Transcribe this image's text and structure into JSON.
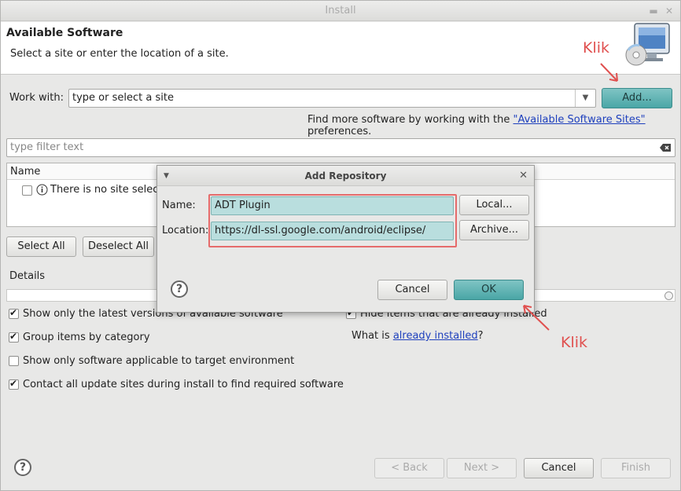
{
  "window": {
    "title": "Install"
  },
  "header": {
    "title": "Available Software",
    "subtitle": "Select a site or enter the location of a site."
  },
  "work_with": {
    "label": "Work with:",
    "value": "type or select a site",
    "add_button": "Add...",
    "hint_prefix": "Find more software by working with the ",
    "hint_link": "\"Available Software Sites\"",
    "hint_suffix": " preferences."
  },
  "filter": {
    "placeholder": "type filter text"
  },
  "tree": {
    "column_name": "Name",
    "empty_row": "There is no site selected"
  },
  "selection_buttons": {
    "select_all": "Select All",
    "deselect_all": "Deselect All"
  },
  "details": {
    "label": "Details"
  },
  "options": [
    {
      "label": "Show only the latest versions of available software",
      "checked": true
    },
    {
      "label": "Group items by category",
      "checked": true
    },
    {
      "label": "Show only software applicable to target environment",
      "checked": false
    },
    {
      "label": "Contact all update sites during install to find required software",
      "checked": true
    }
  ],
  "right_options": {
    "hide_installed": {
      "label": "Hide items that are already installed",
      "checked": true
    },
    "what_is_prefix": "What is ",
    "what_is_link": "already installed",
    "what_is_suffix": "?"
  },
  "footer": {
    "back": "< Back",
    "next": "Next >",
    "cancel": "Cancel",
    "finish": "Finish"
  },
  "dialog": {
    "title": "Add Repository",
    "name_label": "Name:",
    "name_value": "ADT Plugin",
    "location_label": "Location:",
    "location_value": "https://dl-ssl.google.com/android/eclipse/",
    "local_button": "Local...",
    "archive_button": "Archive...",
    "cancel_button": "Cancel",
    "ok_button": "OK"
  },
  "annotations": {
    "klik_top": "Klik",
    "klik_bottom": "Klik",
    "color": "#e0504f"
  }
}
